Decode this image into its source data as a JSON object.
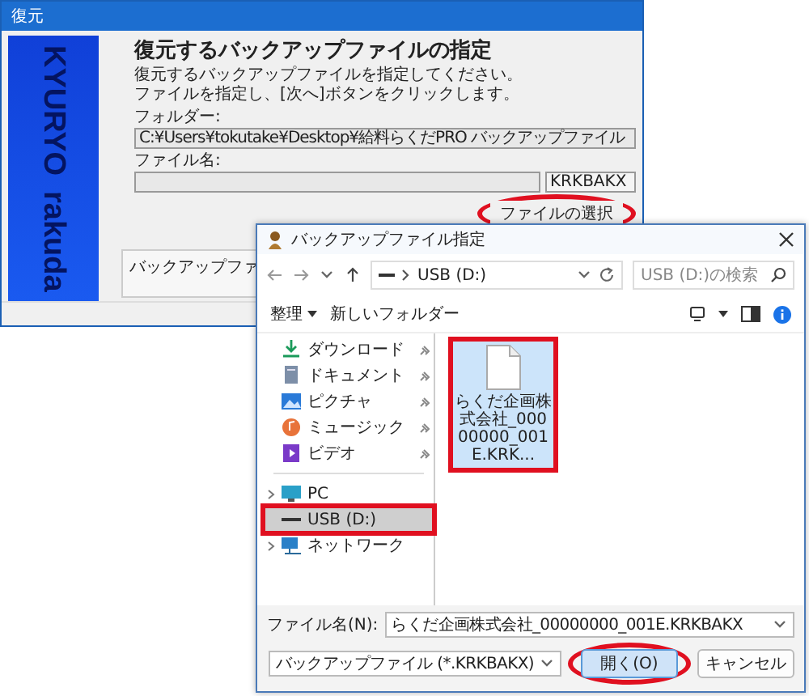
{
  "back_window": {
    "title": "復元",
    "logo": [
      "KYURYO",
      "rakuda"
    ],
    "heading": "復元するバックアップファイルの指定",
    "instructions": [
      "復元するバックアップファイルを指定してください。",
      "ファイルを指定し、[次へ]ボタンをクリックします。"
    ],
    "folder_label": "フォルダー:",
    "folder_value": "C:¥Users¥tokutake¥Desktop¥給料らくだPRO バックアップファイル",
    "file_label": "ファイル名:",
    "extension": "KRKBAKX",
    "select_button": {
      "label": "ファイルの選択",
      "highlighted": true
    },
    "group_label": "バックアップファ"
  },
  "dialog": {
    "title": "バックアップファイル指定",
    "address": "USB (D:)",
    "search": {
      "placeholder": "USB (D:)の検索"
    },
    "toolbar": {
      "organize": "整理",
      "new_folder": "新しいフォルダー"
    },
    "sidebar": [
      {
        "kind": "download",
        "label": "ダウンロード",
        "pinned": true,
        "expandable": false,
        "selected": false,
        "highlighted": false
      },
      {
        "kind": "document",
        "label": "ドキュメント",
        "pinned": true,
        "expandable": false,
        "selected": false,
        "highlighted": false
      },
      {
        "kind": "picture",
        "label": "ピクチャ",
        "pinned": true,
        "expandable": false,
        "selected": false,
        "highlighted": false
      },
      {
        "kind": "music",
        "label": "ミュージック",
        "pinned": true,
        "expandable": false,
        "selected": false,
        "highlighted": false
      },
      {
        "kind": "video",
        "label": "ビデオ",
        "pinned": true,
        "expandable": false,
        "selected": false,
        "highlighted": false
      },
      {
        "kind": "separator"
      },
      {
        "kind": "pc",
        "label": "PC",
        "pinned": false,
        "expandable": true,
        "selected": false,
        "highlighted": false
      },
      {
        "kind": "drive",
        "label": "USB (D:)",
        "pinned": false,
        "expandable": false,
        "selected": true,
        "highlighted": true
      },
      {
        "kind": "network",
        "label": "ネットワーク",
        "pinned": false,
        "expandable": true,
        "selected": false,
        "highlighted": false
      }
    ],
    "files": [
      {
        "name": "らくだ企画株式会社_00000000_001E.KRK...",
        "selected": true,
        "highlighted": true
      }
    ],
    "filename_label": "ファイル名(N):",
    "filename_value": "らくだ企画株式会社_00000000_001E.KRKBAKX",
    "filter": "バックアップファイル (*.KRKBAKX)",
    "buttons": [
      {
        "kind": "primary",
        "label": "開く(O)",
        "highlighted": true
      },
      {
        "kind": "normal",
        "label": "キャンセル",
        "highlighted": false
      }
    ]
  }
}
